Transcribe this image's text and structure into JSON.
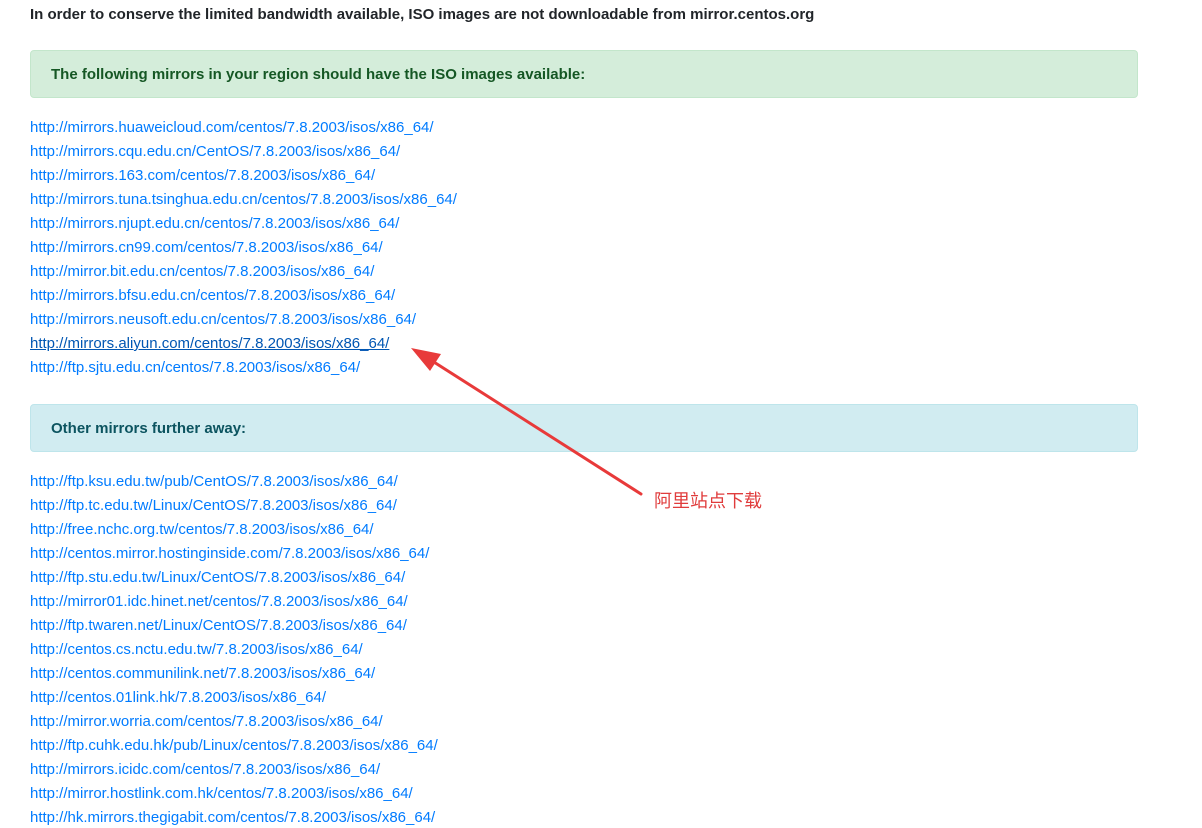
{
  "notice": "In order to conserve the limited bandwidth available, ISO images are not downloadable from mirror.centos.org",
  "region_alert": "The following mirrors in your region should have the ISO images available:",
  "region_mirrors": [
    "http://mirrors.huaweicloud.com/centos/7.8.2003/isos/x86_64/",
    "http://mirrors.cqu.edu.cn/CentOS/7.8.2003/isos/x86_64/",
    "http://mirrors.163.com/centos/7.8.2003/isos/x86_64/",
    "http://mirrors.tuna.tsinghua.edu.cn/centos/7.8.2003/isos/x86_64/",
    "http://mirrors.njupt.edu.cn/centos/7.8.2003/isos/x86_64/",
    "http://mirrors.cn99.com/centos/7.8.2003/isos/x86_64/",
    "http://mirror.bit.edu.cn/centos/7.8.2003/isos/x86_64/",
    "http://mirrors.bfsu.edu.cn/centos/7.8.2003/isos/x86_64/",
    "http://mirrors.neusoft.edu.cn/centos/7.8.2003/isos/x86_64/",
    "http://mirrors.aliyun.com/centos/7.8.2003/isos/x86_64/",
    "http://ftp.sjtu.edu.cn/centos/7.8.2003/isos/x86_64/"
  ],
  "further_alert": "Other mirrors further away:",
  "further_mirrors": [
    "http://ftp.ksu.edu.tw/pub/CentOS/7.8.2003/isos/x86_64/",
    "http://ftp.tc.edu.tw/Linux/CentOS/7.8.2003/isos/x86_64/",
    "http://free.nchc.org.tw/centos/7.8.2003/isos/x86_64/",
    "http://centos.mirror.hostinginside.com/7.8.2003/isos/x86_64/",
    "http://ftp.stu.edu.tw/Linux/CentOS/7.8.2003/isos/x86_64/",
    "http://mirror01.idc.hinet.net/centos/7.8.2003/isos/x86_64/",
    "http://ftp.twaren.net/Linux/CentOS/7.8.2003/isos/x86_64/",
    "http://centos.cs.nctu.edu.tw/7.8.2003/isos/x86_64/",
    "http://centos.communilink.net/7.8.2003/isos/x86_64/",
    "http://centos.01link.hk/7.8.2003/isos/x86_64/",
    "http://mirror.worria.com/centos/7.8.2003/isos/x86_64/",
    "http://ftp.cuhk.edu.hk/pub/Linux/centos/7.8.2003/isos/x86_64/",
    "http://mirrors.icidc.com/centos/7.8.2003/isos/x86_64/",
    "http://mirror.hostlink.com.hk/centos/7.8.2003/isos/x86_64/",
    "http://hk.mirrors.thegigabit.com/centos/7.8.2003/isos/x86_64/"
  ],
  "annotation": "阿里站点下载",
  "colors": {
    "link": "#007bff",
    "link_hover": "#0056b3",
    "success_bg": "#d4edda",
    "success_text": "#155724",
    "info_bg": "#d1ecf1",
    "info_text": "#0c5460",
    "annotation": "#e03c3c"
  }
}
